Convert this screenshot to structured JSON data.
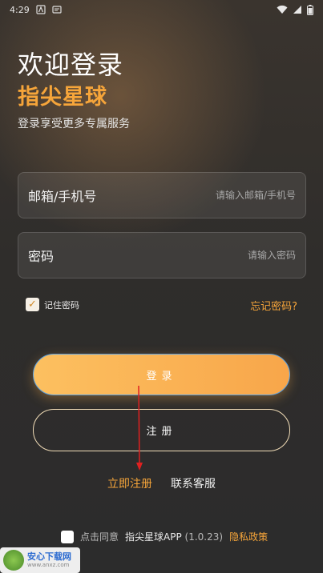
{
  "status_bar": {
    "time": "4:29"
  },
  "header": {
    "title": "欢迎登录",
    "brand": "指尖星球",
    "subtitle": "登录享受更多专属服务"
  },
  "form": {
    "account": {
      "label": "邮箱/手机号",
      "placeholder": "请输入邮箱/手机号",
      "value": ""
    },
    "password": {
      "label": "密码",
      "placeholder": "请输入密码",
      "value": ""
    },
    "remember": {
      "label": "记住密码",
      "checked": true
    },
    "forgot_label": "忘记密码?"
  },
  "buttons": {
    "login": "登录",
    "register": "注册"
  },
  "links": {
    "quick_register": "立即注册",
    "contact": "联系客服"
  },
  "agreement": {
    "prefix": "点击同意",
    "app_name": "指尖星球APP",
    "version": "(1.0.23)",
    "policy": "隐私政策",
    "checked": false
  },
  "watermark": {
    "name": "安心下载网",
    "url": "www.anxz.com"
  },
  "colors": {
    "accent": "#f6a53a",
    "arrow": "#e02020"
  }
}
